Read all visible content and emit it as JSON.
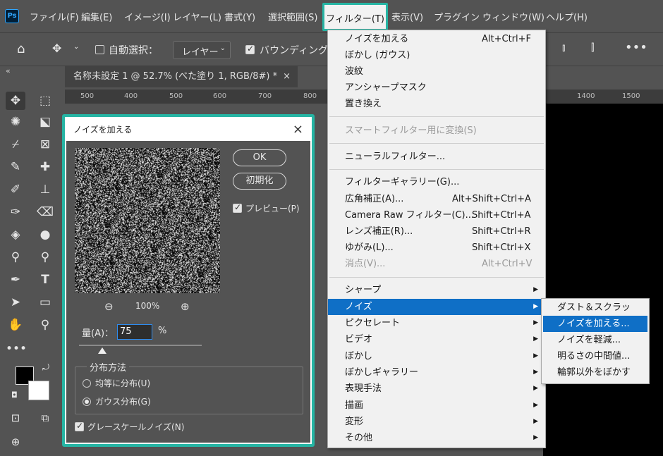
{
  "menubar": {
    "app_logo": "Ps",
    "items": [
      "ファイル(F)",
      "編集(E)",
      "イメージ(I)",
      "レイヤー(L)",
      "書式(Y)",
      "選択範囲(S)",
      "フィルター(T)",
      "表示(V)",
      "プラグイン",
      "ウィンドウ(W)",
      "ヘルプ(H)"
    ],
    "active": "フィルター(T)",
    "highlight_color": "#26b5a4"
  },
  "options_bar": {
    "auto_select_label": "自動選択：",
    "layer_select_value": "レイヤー",
    "bounding_box_label": "バウンディングボ"
  },
  "document": {
    "tab_title": "名称未設定 1 @ 52.7% (べた塗り 1, RGB/8#) *",
    "ruler_ticks": [
      "500",
      "400",
      "500",
      "600",
      "700",
      "800",
      "1400",
      "1500"
    ]
  },
  "dialog": {
    "title": "ノイズを加える",
    "ok_label": "OK",
    "reset_label": "初期化",
    "preview_label": "プレビュー(P)",
    "preview_checked": true,
    "zoom_value": "100%",
    "amount_label": "量(A)：",
    "amount_value": "75",
    "amount_unit": "%",
    "amount_fraction": 0.19,
    "distribution_label": "分布方法",
    "uniform_label": "均等に分布(U)",
    "gaussian_label": "ガウス分布(G)",
    "selected_distribution": "gaussian",
    "mono_label": "グレースケールノイズ(N)",
    "mono_checked": true
  },
  "filter_menu": {
    "items": [
      {
        "label": "ノイズを加える",
        "shortcut": "Alt+Ctrl+F"
      },
      {
        "label": "ぼかし (ガウス)"
      },
      {
        "label": "波紋"
      },
      {
        "label": "アンシャープマスク"
      },
      {
        "label": "置き換え"
      },
      {
        "label": "スマートフィルター用に変換(S)",
        "disabled": true
      },
      {
        "label": "ニューラルフィルター..."
      },
      {
        "label": "フィルターギャラリー(G)..."
      },
      {
        "label": "広角補正(A)...",
        "shortcut": "Alt+Shift+Ctrl+A"
      },
      {
        "label": "Camera Raw フィルター(C)...",
        "shortcut": "Shift+Ctrl+A"
      },
      {
        "label": "レンズ補正(R)...",
        "shortcut": "Shift+Ctrl+R"
      },
      {
        "label": "ゆがみ(L)...",
        "shortcut": "Shift+Ctrl+X"
      },
      {
        "label": "消点(V)...",
        "shortcut": "Alt+Ctrl+V",
        "disabled": true
      },
      {
        "label": "シャープ",
        "submenu": true
      },
      {
        "label": "ノイズ",
        "submenu": true,
        "highlighted": true
      },
      {
        "label": "ピクセレート",
        "submenu": true
      },
      {
        "label": "ビデオ",
        "submenu": true
      },
      {
        "label": "ぼかし",
        "submenu": true
      },
      {
        "label": "ぼかしギャラリー",
        "submenu": true
      },
      {
        "label": "表現手法",
        "submenu": true
      },
      {
        "label": "描画",
        "submenu": true
      },
      {
        "label": "変形",
        "submenu": true
      },
      {
        "label": "その他",
        "submenu": true
      }
    ]
  },
  "noise_submenu": {
    "items": [
      "ダスト＆スクラッチ...",
      "ノイズを加える...",
      "ノイズを軽減...",
      "明るさの中間値...",
      "輪郭以外をぼかす"
    ],
    "highlighted": "ノイズを加える..."
  }
}
